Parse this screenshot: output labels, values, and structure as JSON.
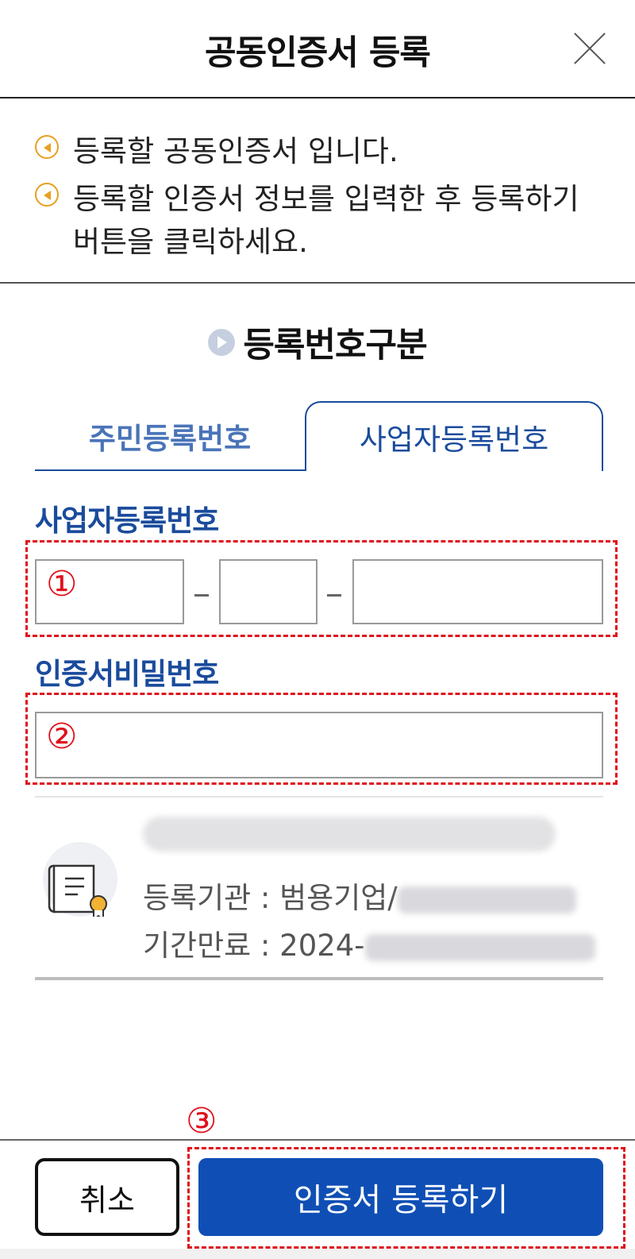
{
  "header": {
    "title": "공동인증서 등록",
    "close_icon": "close-icon"
  },
  "notice": {
    "items": [
      "등록할 공동인증서 입니다.",
      "등록할 인증서 정보를 입력한 후 등록하기 버튼을 클릭하세요."
    ],
    "icon": "speaker-icon",
    "icon_color": "#e8a020"
  },
  "section": {
    "title": "등록번호구분"
  },
  "tabs": {
    "resident": "주민등록번호",
    "business": "사업자등록번호",
    "selected": "business"
  },
  "business_number": {
    "label": "사업자등록번호",
    "annotation": "①",
    "separator": "-"
  },
  "password": {
    "label": "인증서비밀번호",
    "annotation": "②"
  },
  "certificate": {
    "icon": "certificate-icon",
    "issuer_label": "등록기관 : 범용기업/",
    "expiry_label": "기간만료 : 2024-"
  },
  "footer": {
    "cancel_label": "취소",
    "register_label": "인증서 등록하기",
    "annotation": "③"
  },
  "colors": {
    "accent": "#1a4b9c",
    "primary_button": "#0f4fb5",
    "annotation": "#e0101a"
  }
}
